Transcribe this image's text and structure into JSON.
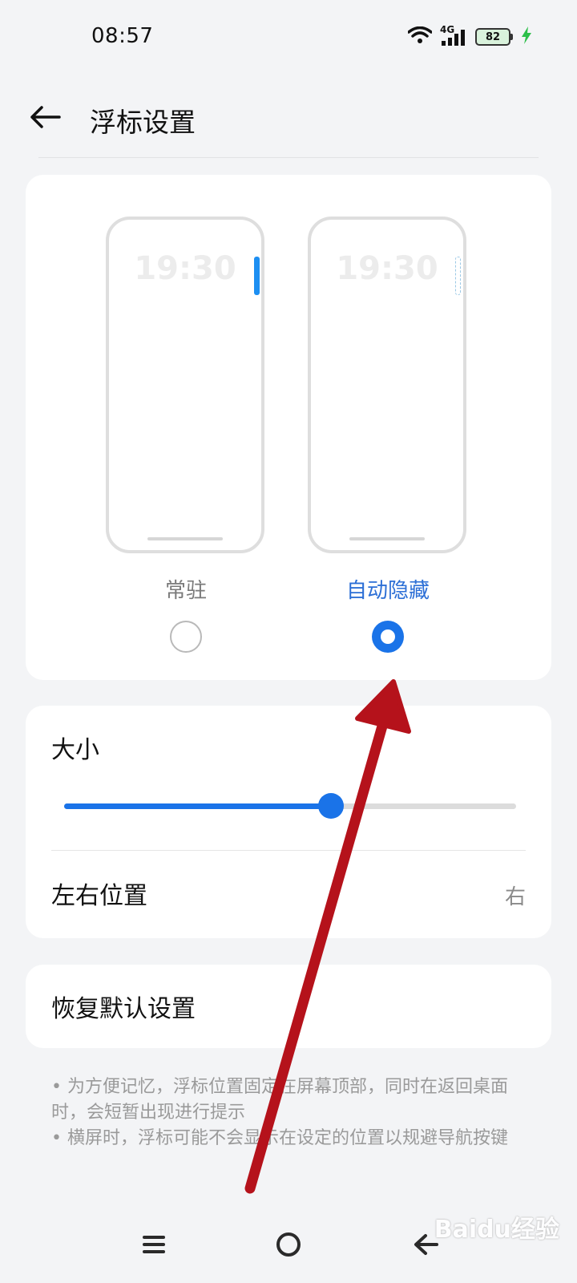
{
  "status_bar": {
    "time": "08:57",
    "network_type": "4G",
    "battery_level": "82",
    "icons": [
      "wifi-icon",
      "cellular-signal-icon",
      "battery-icon",
      "charging-icon"
    ]
  },
  "header": {
    "title": "浮标设置",
    "back_icon": "back-arrow-icon"
  },
  "mode_options": {
    "preview_clock": "19:30",
    "left": {
      "label": "常驻",
      "selected": false
    },
    "right": {
      "label": "自动隐藏",
      "selected": true
    }
  },
  "size": {
    "label": "大小",
    "slider_value_fraction": 0.59
  },
  "position": {
    "label": "左右位置",
    "value": "右"
  },
  "reset": {
    "label": "恢复默认设置"
  },
  "notes": [
    "• 为方便记忆，浮标位置固定在屏幕顶部，同时在返回桌面时，会短暂出现进行提示",
    "• 横屏时，浮标可能不会显示在设定的位置以规避导航按键"
  ],
  "nav_bar": {
    "icons": [
      "menu-icon",
      "home-icon",
      "back-icon"
    ]
  },
  "watermark": {
    "text": "Baidu经验"
  },
  "colors": {
    "accent": "#1a73e8",
    "annotation_arrow": "#b5121b",
    "background": "#f3f4f6"
  }
}
